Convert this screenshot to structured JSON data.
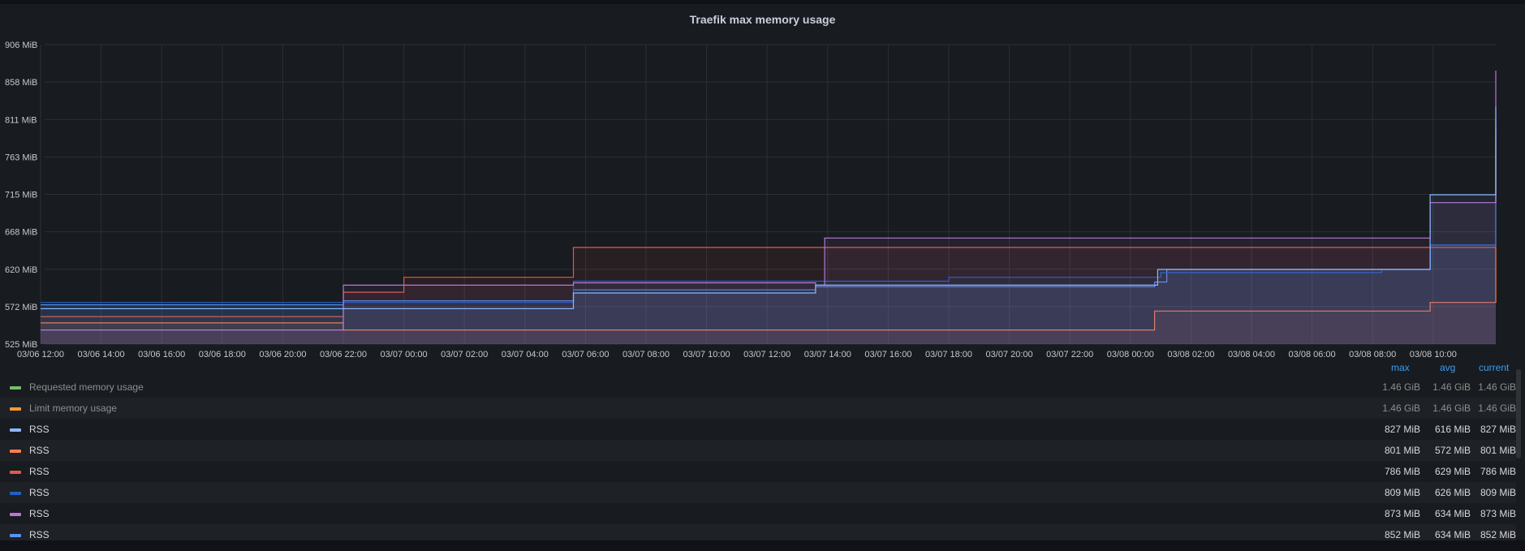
{
  "panel": {
    "title": "Traefik max memory usage"
  },
  "chart_data": {
    "type": "line",
    "title": "Traefik max memory usage",
    "ylim": [
      525,
      906
    ],
    "y_ticks": [
      "906 MiB",
      "858 MiB",
      "811 MiB",
      "763 MiB",
      "715 MiB",
      "668 MiB",
      "620 MiB",
      "572 MiB",
      "525 MiB"
    ],
    "x_ticks": [
      "03/06 12:00",
      "03/06 14:00",
      "03/06 16:00",
      "03/06 18:00",
      "03/06 20:00",
      "03/06 22:00",
      "03/07 00:00",
      "03/07 02:00",
      "03/07 04:00",
      "03/07 06:00",
      "03/07 08:00",
      "03/07 10:00",
      "03/07 12:00",
      "03/07 14:00",
      "03/07 16:00",
      "03/07 18:00",
      "03/07 20:00",
      "03/07 22:00",
      "03/08 00:00",
      "03/08 02:00",
      "03/08 04:00",
      "03/08 06:00",
      "03/08 08:00",
      "03/08 10:00"
    ],
    "x_hours_range": [
      0,
      48.9
    ],
    "grid": true,
    "series": [
      {
        "name": "RSS",
        "color": "#5794f2",
        "points": [
          [
            0,
            575
          ],
          [
            10,
            575
          ],
          [
            10,
            580
          ],
          [
            17.6,
            580
          ],
          [
            17.6,
            594
          ],
          [
            25.6,
            594
          ],
          [
            25.6,
            598
          ],
          [
            36.8,
            598
          ],
          [
            36.8,
            604
          ],
          [
            37.2,
            604
          ],
          [
            37.2,
            620
          ],
          [
            45.9,
            620
          ],
          [
            45.9,
            651
          ],
          [
            51.5,
            651
          ],
          [
            51.5,
            660
          ],
          [
            53.2,
            660
          ],
          [
            53.2,
            760
          ],
          [
            54.8,
            760
          ],
          [
            54.8,
            800
          ],
          [
            56.2,
            800
          ],
          [
            56.2,
            812
          ],
          [
            57.8,
            812
          ],
          [
            57.8,
            812
          ]
        ]
      },
      {
        "name": "RSS",
        "color": "#ff7f50",
        "points": [
          [
            0,
            552
          ],
          [
            10,
            552
          ],
          [
            10,
            543
          ],
          [
            25.6,
            543
          ],
          [
            25.6,
            543
          ],
          [
            36.8,
            543
          ],
          [
            36.8,
            567
          ],
          [
            45.9,
            567
          ],
          [
            45.9,
            578
          ],
          [
            51.5,
            578
          ],
          [
            51.5,
            590
          ],
          [
            53.3,
            590
          ],
          [
            53.3,
            680
          ],
          [
            55,
            680
          ],
          [
            55,
            725
          ],
          [
            56,
            725
          ],
          [
            56,
            765
          ],
          [
            57.8,
            765
          ],
          [
            57.8,
            801
          ]
        ]
      },
      {
        "name": "RSS",
        "color": "#e05a4e",
        "points": [
          [
            0,
            560
          ],
          [
            10,
            560
          ],
          [
            10,
            591
          ],
          [
            12,
            591
          ],
          [
            12,
            610
          ],
          [
            17.6,
            610
          ],
          [
            17.6,
            648
          ],
          [
            45.9,
            648
          ],
          [
            45.9,
            648
          ],
          [
            53.5,
            648
          ],
          [
            53.5,
            690
          ],
          [
            54.8,
            690
          ],
          [
            54.8,
            725
          ],
          [
            56.3,
            725
          ],
          [
            56.3,
            786
          ],
          [
            57.8,
            786
          ]
        ]
      },
      {
        "name": "RSS",
        "color": "#1f60c4",
        "points": [
          [
            0,
            578
          ],
          [
            10,
            578
          ],
          [
            10,
            578
          ],
          [
            17.6,
            578
          ],
          [
            17.6,
            605
          ],
          [
            30,
            605
          ],
          [
            30,
            610
          ],
          [
            37,
            610
          ],
          [
            37,
            616
          ],
          [
            44.3,
            616
          ],
          [
            44.3,
            620
          ],
          [
            45.9,
            620
          ],
          [
            45.9,
            651
          ],
          [
            53.8,
            651
          ],
          [
            53.8,
            700
          ],
          [
            55.2,
            700
          ],
          [
            55.2,
            760
          ],
          [
            56.3,
            760
          ],
          [
            56.3,
            809
          ],
          [
            57.8,
            809
          ]
        ]
      },
      {
        "name": "RSS",
        "color": "#b877d9",
        "points": [
          [
            0,
            543
          ],
          [
            10,
            543
          ],
          [
            10,
            600
          ],
          [
            17.6,
            600
          ],
          [
            17.6,
            603
          ],
          [
            25.6,
            603
          ],
          [
            25.6,
            600
          ],
          [
            25.9,
            600
          ],
          [
            25.9,
            660
          ],
          [
            45.9,
            660
          ],
          [
            45.9,
            705
          ],
          [
            53.6,
            705
          ],
          [
            53.6,
            760
          ],
          [
            55,
            760
          ],
          [
            55,
            800
          ],
          [
            56.1,
            800
          ],
          [
            56.1,
            873
          ],
          [
            57.8,
            873
          ]
        ]
      },
      {
        "name": "RSS",
        "color": "#8ab8ff",
        "points": [
          [
            0,
            570
          ],
          [
            10,
            570
          ],
          [
            10,
            570
          ],
          [
            17.6,
            570
          ],
          [
            17.6,
            590
          ],
          [
            25.6,
            590
          ],
          [
            25.6,
            600
          ],
          [
            36.9,
            600
          ],
          [
            36.9,
            620
          ],
          [
            45.9,
            620
          ],
          [
            45.9,
            715
          ],
          [
            53.4,
            715
          ],
          [
            53.4,
            770
          ],
          [
            54.5,
            770
          ],
          [
            54.5,
            810
          ],
          [
            56.2,
            810
          ],
          [
            56.2,
            827
          ],
          [
            57.8,
            827
          ]
        ]
      }
    ]
  },
  "legend": {
    "headers": {
      "max": "max",
      "avg": "avg",
      "current": "current"
    },
    "rows": [
      {
        "name": "Requested memory usage",
        "color": "#73bf69",
        "max": "1.46 GiB",
        "avg": "1.46 GiB",
        "current": "1.46 GiB",
        "dim": true
      },
      {
        "name": "Limit memory usage",
        "color": "#ff9830",
        "max": "1.46 GiB",
        "avg": "1.46 GiB",
        "current": "1.46 GiB",
        "dim": true
      },
      {
        "name": "RSS",
        "color": "#8ab8ff",
        "max": "827 MiB",
        "avg": "616 MiB",
        "current": "827 MiB"
      },
      {
        "name": "RSS",
        "color": "#ff7f50",
        "max": "801 MiB",
        "avg": "572 MiB",
        "current": "801 MiB"
      },
      {
        "name": "RSS",
        "color": "#e05a4e",
        "max": "786 MiB",
        "avg": "629 MiB",
        "current": "786 MiB"
      },
      {
        "name": "RSS",
        "color": "#1f60c4",
        "max": "809 MiB",
        "avg": "626 MiB",
        "current": "809 MiB"
      },
      {
        "name": "RSS",
        "color": "#b877d9",
        "max": "873 MiB",
        "avg": "634 MiB",
        "current": "873 MiB"
      },
      {
        "name": "RSS",
        "color": "#5794f2",
        "max": "852 MiB",
        "avg": "634 MiB",
        "current": "852 MiB"
      }
    ]
  }
}
